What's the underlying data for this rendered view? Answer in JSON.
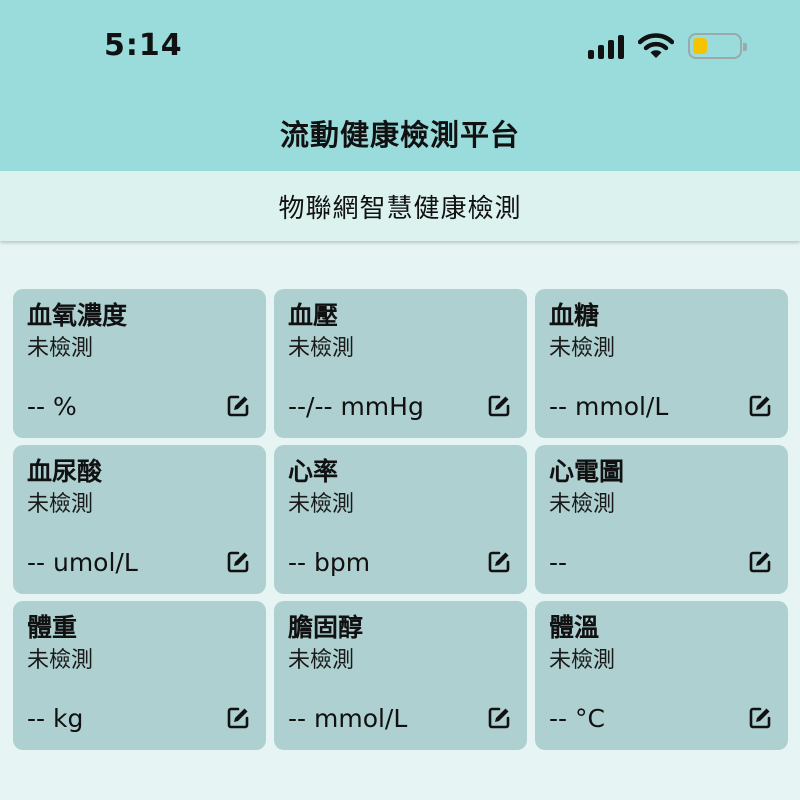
{
  "status_bar": {
    "time": "5:14"
  },
  "header": {
    "title": "流動健康檢測平台"
  },
  "sub_header": {
    "title": "物聯網智慧健康檢測"
  },
  "cards": [
    {
      "title": "血氧濃度",
      "status": "未檢測",
      "value": "-- %"
    },
    {
      "title": "血壓",
      "status": "未檢測",
      "value": "--/-- mmHg"
    },
    {
      "title": "血糖",
      "status": "未檢測",
      "value": "-- mmol/L"
    },
    {
      "title": "血尿酸",
      "status": "未檢測",
      "value": "-- umol/L"
    },
    {
      "title": "心率",
      "status": "未檢測",
      "value": "-- bpm"
    },
    {
      "title": "心電圖",
      "status": "未檢測",
      "value": "--"
    },
    {
      "title": "體重",
      "status": "未檢測",
      "value": "-- kg"
    },
    {
      "title": "膽固醇",
      "status": "未檢測",
      "value": "-- mmol/L"
    },
    {
      "title": "體溫",
      "status": "未檢測",
      "value": "-- °C"
    }
  ],
  "colors": {
    "header_bg": "#9adcdb",
    "sub_header_bg": "#dcf2ee",
    "page_bg": "#e6f4f3",
    "card_bg": "#aed0d0",
    "battery_fill": "#f5c300"
  },
  "icons": {
    "signal": "cellular-signal-icon",
    "wifi": "wifi-icon",
    "battery": "battery-icon",
    "edit": "edit-icon"
  }
}
